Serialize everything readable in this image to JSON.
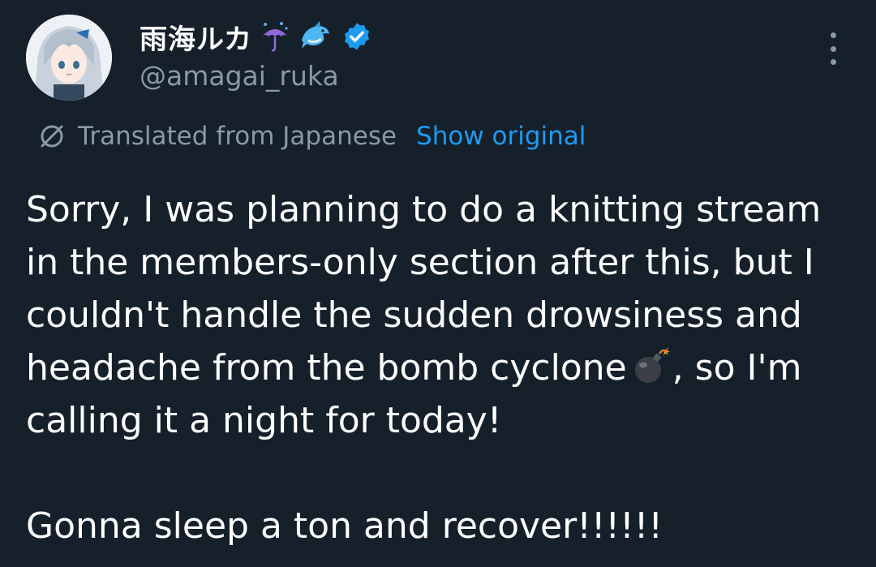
{
  "author": {
    "display_name": "雨海ルカ",
    "handle": "@amagai_ruka",
    "emojis": [
      "umbrella-with-rain-icon",
      "dolphin-icon"
    ],
    "verified": true,
    "verified_color": "#1d9bf0"
  },
  "translation": {
    "label": "Translated from Japanese",
    "show_original": "Show original"
  },
  "tweet": {
    "lines": [
      "Sorry, I was planning to do a knitting stream",
      "in the members-only section after this, but I",
      "couldn't handle the sudden drowsiness and",
      "headache from the bomb cyclone",
      ", so I'm",
      "calling it a night for today!",
      "Gonna sleep a ton and recover!!!!!!"
    ],
    "inline_emoji": "bomb-icon"
  },
  "colors": {
    "background": "#15202b",
    "text": "#ffffff",
    "secondary": "#8b98a5",
    "link": "#1d9bf0"
  }
}
